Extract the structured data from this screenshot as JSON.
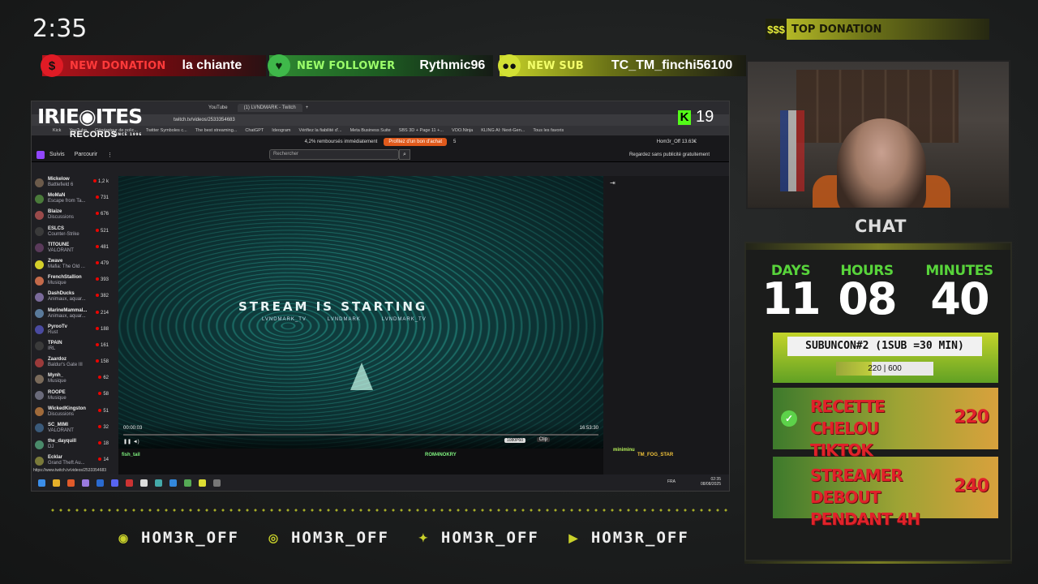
{
  "overlay": {
    "clock": "2:35",
    "alerts": {
      "donation": {
        "tag": "NEW DONATION",
        "value": "la chiante"
      },
      "follower": {
        "tag": "NEW FOLLOWER",
        "value": "Rythmic96"
      },
      "sub": {
        "tag": "NEW SUB",
        "value": "TC_TM_finchi56100"
      }
    },
    "top_donation": {
      "badge": "$$$",
      "tag": "TOP DONATION"
    },
    "brand": {
      "name": "IRIE◉ITES",
      "since": "SINCE 1996",
      "sub": "RECORDS"
    },
    "kick": {
      "letter": "K",
      "count": "19"
    },
    "chat_title": "CHAT",
    "timer": {
      "days_label": "DAYS",
      "days": "11",
      "hours_label": "HOURS",
      "hours": "08",
      "minutes_label": "MINUTES",
      "minutes": "40"
    },
    "subathon": {
      "title": "SUBUNCON#2 (1SUB =30 MIN)",
      "current": "220",
      "goal": "600",
      "progress_text": "220 | 600",
      "fraction": 0.367
    },
    "goals": [
      {
        "line1": "RECETTE CHELOU",
        "line2": "TIKTOK",
        "value": "220",
        "done": true
      },
      {
        "line1": "STREAMER DEBOUT",
        "line2": "PENDANT 4H",
        "value": "240",
        "done": false
      }
    ],
    "socials": [
      {
        "icon": "discord-icon",
        "handle": "HOM3R_OFF"
      },
      {
        "icon": "instagram-icon",
        "handle": "HOM3R_OFF"
      },
      {
        "icon": "twitter-icon",
        "handle": "HOM3R_OFF"
      },
      {
        "icon": "youtube-icon",
        "handle": "HOM3R_OFF"
      }
    ]
  },
  "browser": {
    "tabs": [
      "YouTube",
      "(1) LVNDMARK - Twitch"
    ],
    "url": "twitch.tv/videos/2533354683",
    "bookmarks": [
      "Kick",
      "YouTube",
      "Générateur de polic...",
      "Twitter Symboles c...",
      "The best streaming...",
      "ChatGPT",
      "Ideogram",
      "Vérifiez la fiabilité d'...",
      "Meta Business Suite",
      "SBS 3D + Page 11 +...",
      "VOO.Ninja",
      "KLING AI: Next-Gen...",
      "Tous les favoris"
    ],
    "promo": {
      "text": "4,2% remboursés immédiatement",
      "button": "Profitez d'un bon d'achat",
      "points": "5"
    },
    "twitch": {
      "nav_follow": "Suivis",
      "nav_browse": "Parcourir",
      "search_placeholder": "Rechercher",
      "noads": "Regardez sans publicité gratuitement",
      "user": "Hom3r_Off",
      "bits": "13.63€"
    },
    "channels": [
      {
        "name": "Mickelow",
        "game": "Battlefield 6",
        "viewers": "1,2 k",
        "color": "#6b5a4a"
      },
      {
        "name": "MoMaN",
        "game": "Escape from Ta...",
        "viewers": "731",
        "color": "#4a7a3a"
      },
      {
        "name": "Blaize",
        "game": "Discussions",
        "viewers": "676",
        "color": "#9a4a4a"
      },
      {
        "name": "ESLCS",
        "game": "Counter-Strike",
        "viewers": "521",
        "color": "#3a3a3a"
      },
      {
        "name": "TITOUNE",
        "game": "VALORANT",
        "viewers": "481",
        "color": "#5a3a5a"
      },
      {
        "name": "Zwave",
        "game": "Mafia: The Old ...",
        "viewers": "479",
        "color": "#d4cf2a"
      },
      {
        "name": "FrenchStallion",
        "game": "Musique",
        "viewers": "393",
        "color": "#c46a4a"
      },
      {
        "name": "DashDucks",
        "game": "Animaux, aquar...",
        "viewers": "382",
        "color": "#7a6a9a"
      },
      {
        "name": "MarineMammal...",
        "game": "Animaux, aquar...",
        "viewers": "214",
        "color": "#5a7a9a"
      },
      {
        "name": "PyrooTv",
        "game": "Rust",
        "viewers": "188",
        "color": "#4a4aa0"
      },
      {
        "name": "TPAIN",
        "game": "IRL",
        "viewers": "161",
        "color": "#3a3a3a"
      },
      {
        "name": "Zaardoz",
        "game": "Baldur's Gate III",
        "viewers": "158",
        "color": "#9a3a3a"
      },
      {
        "name": "Mynh_",
        "game": "Musique",
        "viewers": "62",
        "color": "#7a6a5a"
      },
      {
        "name": "ROOPE",
        "game": "Musique",
        "viewers": "58",
        "color": "#6a6a7a"
      },
      {
        "name": "WickedKingston",
        "game": "Discussions",
        "viewers": "51",
        "color": "#a06a3a"
      },
      {
        "name": "SC_MIMI",
        "game": "VALORANT",
        "viewers": "32",
        "color": "#3a5a7a"
      },
      {
        "name": "the_dayquill",
        "game": "DJ",
        "viewers": "18",
        "color": "#4a8a6a"
      },
      {
        "name": "Ecklar",
        "game": "Grand Theft Au...",
        "viewers": "14",
        "color": "#7a7a3a"
      }
    ],
    "player": {
      "title": "STREAM IS STARTING",
      "handles": [
        "LVNDMARK_TV",
        "LVNDMARK",
        "LVNDMARK_TV"
      ],
      "time_current": "00:00:03",
      "time_total": "16:53:30",
      "quality": "1080P60",
      "clip": "Clip"
    },
    "below_names": [
      "fish_tail",
      "ROM4NOKRY"
    ],
    "mini_names": [
      "miniminu",
      "TM_FOG_STAR"
    ],
    "status_url": "https://www.twitch.tv/videos/2533354683",
    "taskbar": {
      "lang": "FRA",
      "time": "02:35",
      "date": "08/08/2025"
    }
  }
}
